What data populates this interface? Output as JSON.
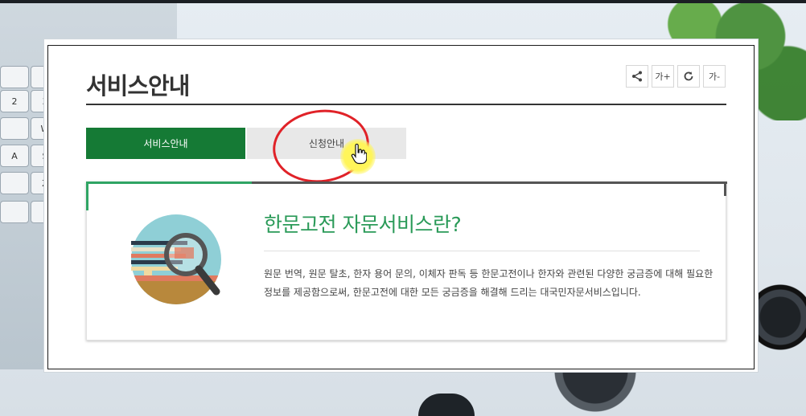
{
  "page": {
    "title": "서비스안내"
  },
  "toolbar": {
    "share_icon": "share-icon",
    "font_increase_label": "가+",
    "refresh_icon": "refresh-icon",
    "font_decrease_label": "가-"
  },
  "tabs": [
    {
      "label": "서비스안내",
      "active": true
    },
    {
      "label": "신청안내",
      "active": false
    }
  ],
  "card": {
    "title": "한문고전 자문서비스란?",
    "description": "원문 번역, 원문 탈초, 한자 용어 문의, 이체자 판독 등 한문고전이나 한자와 관련된 다양한 궁금증에 대해 필요한 정보를 제공함으로써, 한문고전에 대한 모든 궁금증을 해결해 드리는 대국민자문서비스입니다.",
    "illustration_icon": "magnifier-books-icon"
  },
  "colors": {
    "accent_green": "#157a35",
    "title_green": "#2a9a58",
    "annotation_red": "#e02228",
    "cursor_highlight": "#fff55a"
  }
}
